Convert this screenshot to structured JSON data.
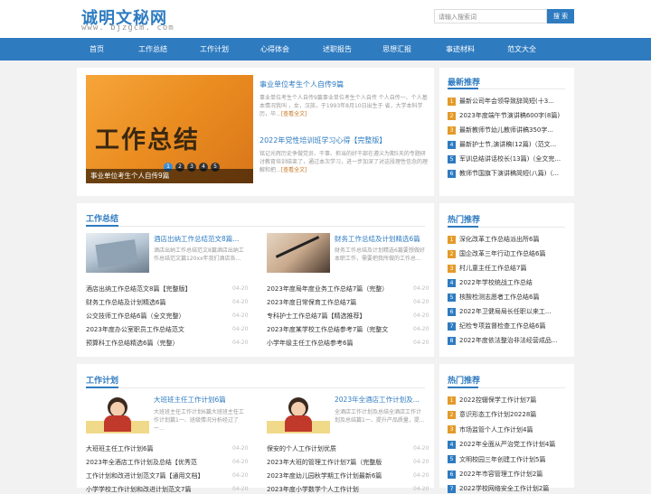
{
  "header": {
    "logo": "诚明文秘网",
    "domain": "www. bjzgcm. com",
    "search_placeholder": "请输入搜索词",
    "search_button": "搜 索"
  },
  "nav": [
    "首页",
    "工作总结",
    "工作计划",
    "心得体会",
    "述职报告",
    "思想汇报",
    "事迹材料",
    "范文大全"
  ],
  "featured": {
    "image_text": "工作总结",
    "caption": "事业单位考生个人自传9篇",
    "dots": [
      "1",
      "2",
      "3",
      "4",
      "5"
    ],
    "articles": [
      {
        "title": "事业单位考生个人自传9篇",
        "excerpt": "事业单位考生个人自传9篇事业单位考生个人自传 个人自传一、个人基本情况我叫 ，女，汉族，于1993年8月10日出生于 省，大学本科学历，毕...",
        "more": "[查看全文]"
      },
      {
        "title": "2022年党性培训班学习心得【完整版】",
        "excerpt": "铭记光辉历史争做党员、干事、担当的好干部在遵义为期5天的专题研讨教育培训结束了，通过本次学习，进一步加深了对这段理性信念的理解和把...",
        "more": "[查看全文]"
      }
    ]
  },
  "latest": {
    "title": "最新推荐",
    "items": [
      "最新公司年会领导致辞简短(十3...",
      "2023年度端午节演讲稿600字(8篇)",
      "最新教师节幼儿教师讲稿350字...",
      "最新护士节,演讲稿(12篇)（范文...",
      "军训总结讲话校长(13篇)（全文完...",
      "教师节国旗下演讲稿简短(八篇)（..."
    ]
  },
  "hot": {
    "title": "热门推荐",
    "items": [
      "深化改革工作总结派出所6篇",
      "国企改革三年行动工作总结6篇",
      "村儿童主任工作总结7篇",
      "2022年学校统战工作总结",
      "核酸检测志愿者工作总结6篇",
      "2022年卫健局局长任职以来工...",
      "纪检专项监督检查工作总结6篇",
      "2022年度依法整治非法经营成品..."
    ]
  },
  "hot2": {
    "title": "热门推荐",
    "items": [
      "2022控辍保学工作计划7篇",
      "意识形态工作计划20228篇",
      "市场监管个人工作计划4篇",
      "2022年全面从严治党工作计划4篇",
      "文明校园三年创建工作计划5篇",
      "2022年市容管理工作计划2篇",
      "2022学校网络安全工作计划2篇"
    ]
  },
  "section1": {
    "title": "工作总结",
    "subs": [
      {
        "title": "酒店出纳工作总结范文8篇...",
        "excerpt": "酒店出纳工作总结范文8篇酒店出纳工作总结范文篇120xx年我们酒店各..."
      },
      {
        "title": "财务工作总结及计划精选6篇",
        "excerpt": "财务工作总结及计划精选6篇要想做好本职工作，需要把我所做的工作总..."
      }
    ],
    "left": [
      [
        "酒店出纳工作总结范文8篇【完整版】",
        "04-20"
      ],
      [
        "财务工作总结及计划精选6篇",
        "04-20"
      ],
      [
        "公交技师工作总结6篇（全文完整）",
        "04-20"
      ],
      [
        "2023年度办公室职员工作总结范文",
        "04-20"
      ],
      [
        "预算科工作总结精选6篇（完整）",
        "04-20"
      ]
    ],
    "right": [
      [
        "2023年度局年度业务工作总结7篇（完整）",
        "04-20"
      ],
      [
        "2023年度日常保育工作总结7篇",
        "04-20"
      ],
      [
        "专科护士工作总结7篇【精选推荐】",
        "04-20"
      ],
      [
        "2023年度某学校工作总结参考7篇（完整文",
        "04-20"
      ],
      [
        "小学年级主任工作总结参考6篇",
        "04-20"
      ]
    ]
  },
  "section2": {
    "title": "工作计划",
    "subs": [
      {
        "title": "大班班主任工作计划6篇",
        "excerpt": "大班班主任工作计划6篇大班班主任工作计划篇1一、班级情况分析经过了一..."
      },
      {
        "title": "2023年全酒店工作计划及...",
        "excerpt": "全酒店工作计划及总结全酒店工作计划及总结篇1一、提升产品质量，提..."
      }
    ],
    "left": [
      [
        "大班班主任工作计划6篇",
        "04-20"
      ],
      [
        "2023年全酒店工作计划及总结【优秀范",
        "04-20"
      ],
      [
        "工作计划和改进计划范文7篇【通用文档】",
        "04-20"
      ],
      [
        "小学学校工作计划和改进计划范文7篇",
        "04-20"
      ]
    ],
    "right": [
      [
        "保安的个人工作计划优质",
        "04-20"
      ],
      [
        "2023年大班的管理工作计划7篇（完整版",
        "04-20"
      ],
      [
        "2023年度幼儿园秋学期工作计划最新6篇",
        "04-20"
      ],
      [
        "2023年度小学数学个人工作计划",
        "04-20"
      ]
    ]
  },
  "colors": {
    "brand": "#2e7bc0",
    "accent": "#e49a28"
  }
}
